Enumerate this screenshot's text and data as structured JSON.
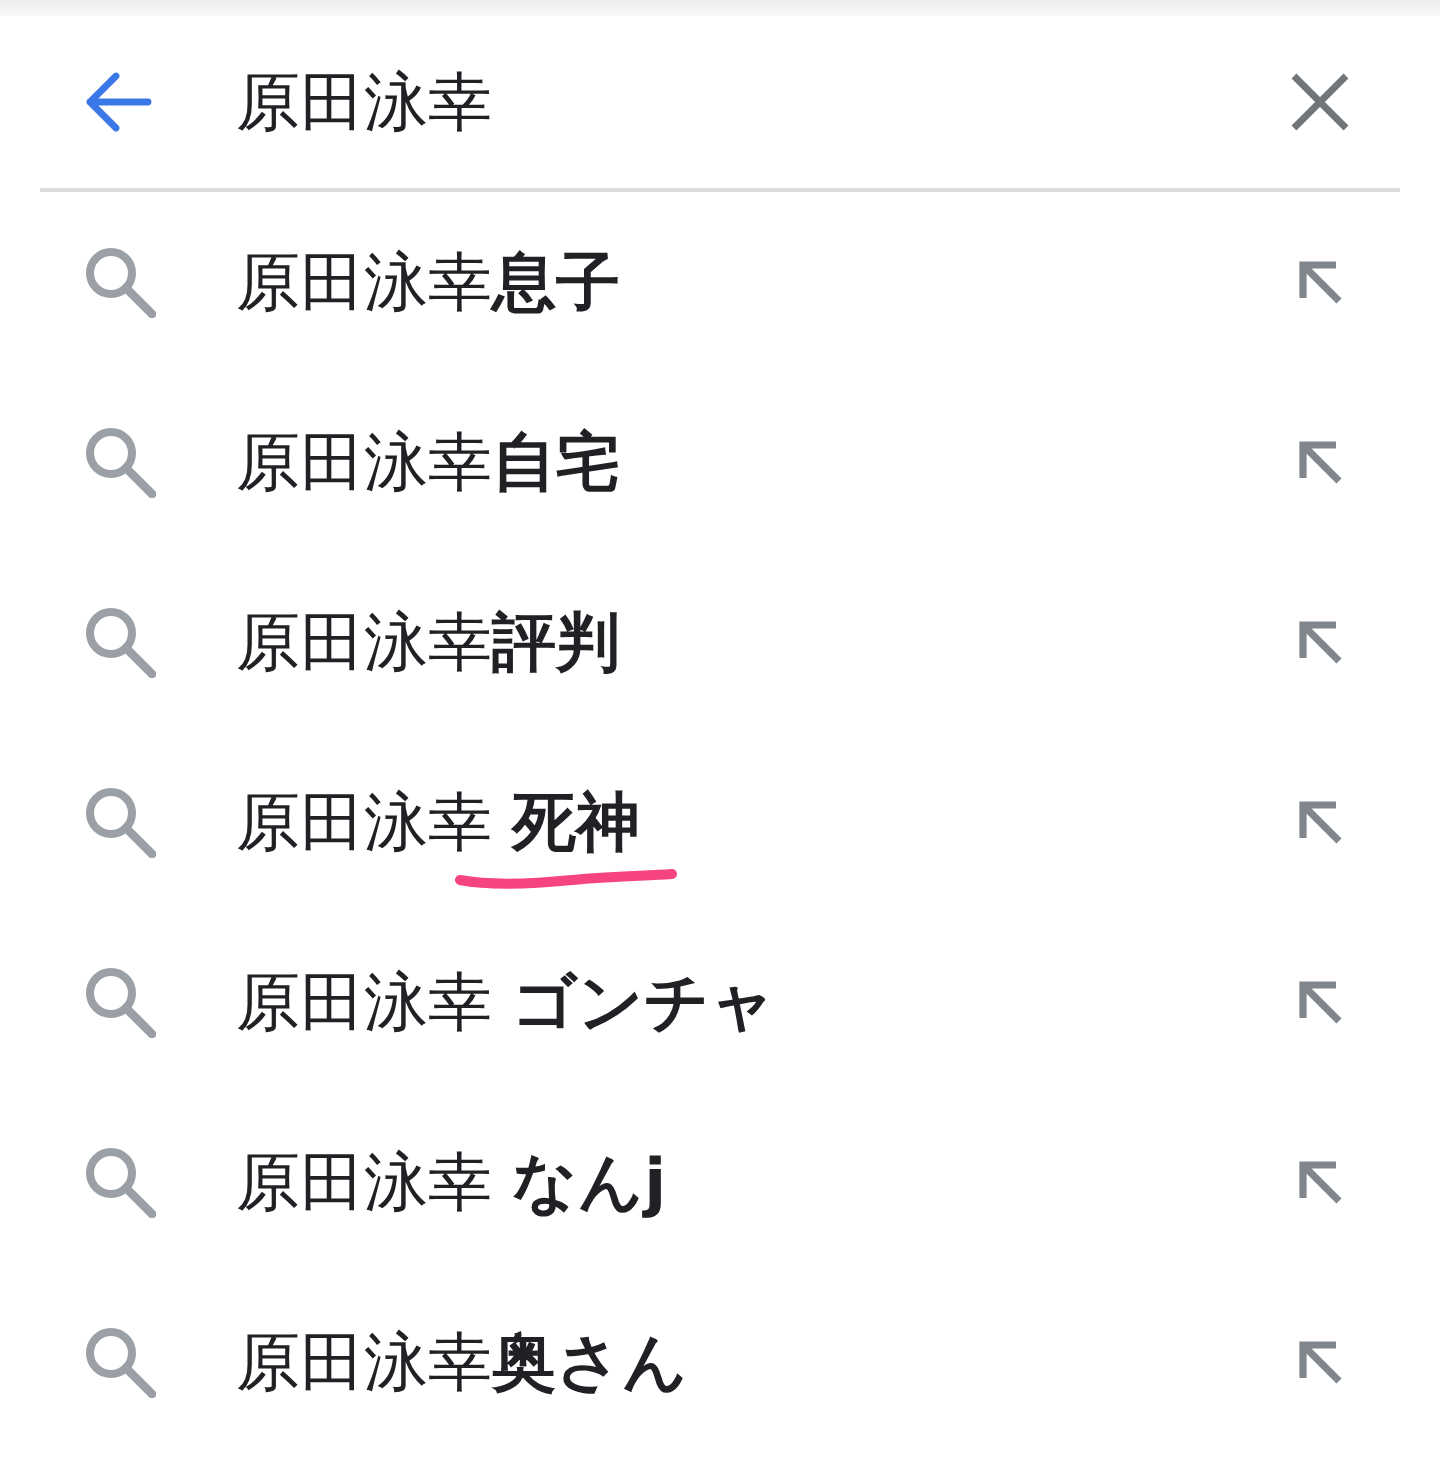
{
  "header": {
    "query": "原田泳幸"
  },
  "suggestions": [
    {
      "text": "原田泳幸**息子**",
      "underlined": false
    },
    {
      "text": "原田泳幸**自宅**",
      "underlined": false
    },
    {
      "text": "原田泳幸**評判**",
      "underlined": false
    },
    {
      "text": "原田泳幸 **死神**",
      "underlined": true
    },
    {
      "text": "原田泳幸 **ゴンチャ**",
      "underlined": false
    },
    {
      "text": "原田泳幸 **なんj**",
      "underlined": false
    },
    {
      "text": "原田泳幸**奥さん**",
      "underlined": false
    }
  ]
}
